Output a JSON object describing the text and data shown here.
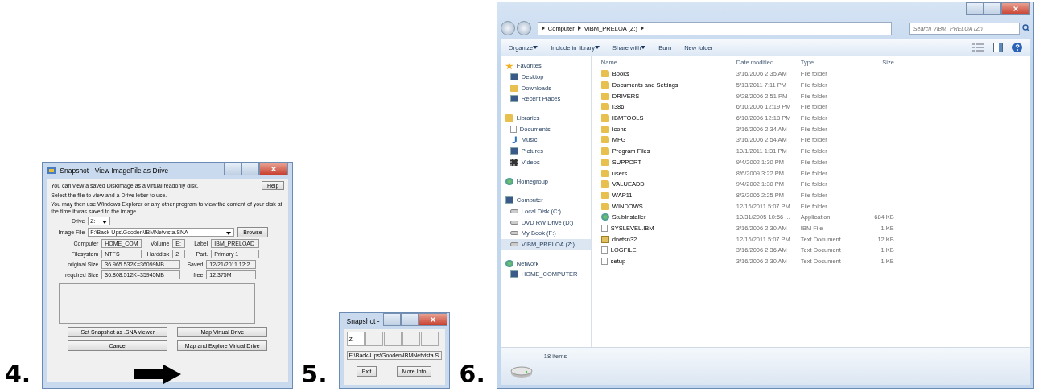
{
  "view_dialog": {
    "step": "4.",
    "title": "Snapshot - View ImageFile as Drive",
    "help_button": "Help",
    "intro": "You can view a saved DiskImage as a virtual readonly disk.",
    "instruction": "Select the file to view and a Drive letter to use.",
    "note": "You may then use Windows Explorer or any other program to view the content of your disk at the time it was saved to the image.",
    "drive": {
      "label": "Drive",
      "value": "Z:"
    },
    "image_file": {
      "label": "Image File",
      "value": "F:\\Back-Ups\\Gooden\\IBMNetvista.SNA"
    },
    "browse_button": "Browse",
    "info_rows": [
      [
        {
          "label": "Computer",
          "value": "HOME_COM"
        },
        {
          "label": "Volume",
          "value": "E:"
        },
        {
          "label": "Label",
          "value": "IBM_PRELOAD"
        }
      ],
      [
        {
          "label": "Filesystem",
          "value": "NTFS"
        },
        {
          "label": "Harddisk",
          "value": "2"
        },
        {
          "label": "Part.",
          "value": "Primary 1"
        }
      ],
      [
        {
          "label": "original Size",
          "value": "36.965.532K=36099MB"
        },
        {
          "label": "Saved",
          "value": "12/21/2011 12:2"
        }
      ],
      [
        {
          "label": "required Size",
          "value": "36.808.512K=35945MB"
        },
        {
          "label": "free",
          "value": "12.375M"
        }
      ]
    ],
    "buttons": [
      "Set Snapshot as .SNA viewer",
      "Map Virtual Drive",
      "Cancel",
      "Map and Explore Virtual Drive"
    ]
  },
  "mini_dialog": {
    "step": "5.",
    "title": "Snapshot -",
    "drive_buttons": [
      "Z:"
    ],
    "path": "F:\\Back-Ups\\Gooden\\IBMNetvista.S",
    "buttons": [
      "Exit",
      "More Info"
    ]
  },
  "explorer": {
    "step": "6.",
    "address": [
      "Computer",
      "VIBM_PRELOA (Z:)"
    ],
    "search": {
      "placeholder": "Search VIBM_PRELOA (Z:)"
    },
    "toolbar": [
      {
        "label": "Organize",
        "dropdown": true
      },
      {
        "label": "Include in library",
        "dropdown": true
      },
      {
        "label": "Share with",
        "dropdown": true
      },
      {
        "label": "Burn",
        "dropdown": false
      },
      {
        "label": "New folder",
        "dropdown": false
      }
    ],
    "columns": [
      "Name",
      "Date modified",
      "Type",
      "Size"
    ],
    "sidebar": [
      {
        "label": "Favorites",
        "kind": "star",
        "selected": false,
        "children": [
          {
            "label": "Desktop",
            "kind": "monitor",
            "selected": false
          },
          {
            "label": "Downloads",
            "kind": "folder",
            "selected": false
          },
          {
            "label": "Recent Places",
            "kind": "monitor",
            "selected": false
          }
        ]
      },
      {
        "label": "Libraries",
        "kind": "folder",
        "selected": false,
        "children": [
          {
            "label": "Documents",
            "kind": "document",
            "selected": false
          },
          {
            "label": "Music",
            "kind": "note",
            "selected": false
          },
          {
            "label": "Pictures",
            "kind": "monitor",
            "selected": false
          },
          {
            "label": "Videos",
            "kind": "film",
            "selected": false
          }
        ]
      },
      {
        "label": "Homegroup",
        "kind": "globe",
        "selected": false
      },
      {
        "label": "Computer",
        "kind": "monitor",
        "selected": false,
        "children": [
          {
            "label": "Local Disk (C:)",
            "kind": "drive",
            "selected": false
          },
          {
            "label": "DVD RW Drive (D:)",
            "kind": "drive",
            "selected": false
          },
          {
            "label": "My Book (F:)",
            "kind": "drive",
            "selected": false
          },
          {
            "label": "VIBM_PRELOA (Z:)",
            "kind": "drive",
            "selected": true
          }
        ]
      },
      {
        "label": "Network",
        "kind": "globe",
        "selected": false,
        "children": [
          {
            "label": "HOME_COMPUTER",
            "kind": "monitor",
            "selected": false
          }
        ]
      }
    ],
    "files": [
      {
        "name": "Books",
        "date": "3/16/2006 2:35 AM",
        "type": "File folder",
        "kind": "folder"
      },
      {
        "name": "Documents and Settings",
        "date": "5/13/2011 7:11 PM",
        "type": "File folder",
        "kind": "folder"
      },
      {
        "name": "DRIVERS",
        "date": "9/28/2006 2:51 PM",
        "type": "File folder",
        "kind": "folder"
      },
      {
        "name": "I386",
        "date": "6/10/2006 12:19 PM",
        "type": "File folder",
        "kind": "folder"
      },
      {
        "name": "IBMTOOLS",
        "date": "6/10/2006 12:18 PM",
        "type": "File folder",
        "kind": "folder"
      },
      {
        "name": "icons",
        "date": "3/16/2006 2:34 AM",
        "type": "File folder",
        "kind": "folder"
      },
      {
        "name": "MFG",
        "date": "3/16/2006 2:54 AM",
        "type": "File folder",
        "kind": "folder"
      },
      {
        "name": "Program Files",
        "date": "10/1/2011 1:31 PM",
        "type": "File folder",
        "kind": "folder"
      },
      {
        "name": "SUPPORT",
        "date": "9/4/2002 1:30 PM",
        "type": "File folder",
        "kind": "folder"
      },
      {
        "name": "users",
        "date": "8/6/2009 3:22 PM",
        "type": "File folder",
        "kind": "folder"
      },
      {
        "name": "VALUEADD",
        "date": "9/4/2002 1:30 PM",
        "type": "File folder",
        "kind": "folder"
      },
      {
        "name": "WAP11",
        "date": "8/3/2006 2:25 PM",
        "type": "File folder",
        "kind": "folder"
      },
      {
        "name": "WINDOWS",
        "date": "12/16/2011 5:07 PM",
        "type": "File folder",
        "kind": "folder"
      },
      {
        "name": "StubInstaller",
        "date": "10/31/2005 10:56 ...",
        "type": "Application",
        "size": "684 KB",
        "kind": "app"
      },
      {
        "name": "SYSLEVEL.IBM",
        "date": "3/16/2006 2:30 AM",
        "type": "IBM File",
        "size": "1 KB",
        "kind": "file"
      },
      {
        "name": "drwtsn32",
        "date": "12/16/2011 5:07 PM",
        "type": "Text Document",
        "size": "12 KB",
        "kind": "locked"
      },
      {
        "name": "LOGFILE",
        "date": "3/16/2006 2:36 AM",
        "type": "Text Document",
        "size": "1 KB",
        "kind": "file"
      },
      {
        "name": "setup",
        "date": "3/16/2006 2:30 AM",
        "type": "Text Document",
        "size": "1 KB",
        "kind": "file"
      }
    ],
    "status": "18 items"
  }
}
